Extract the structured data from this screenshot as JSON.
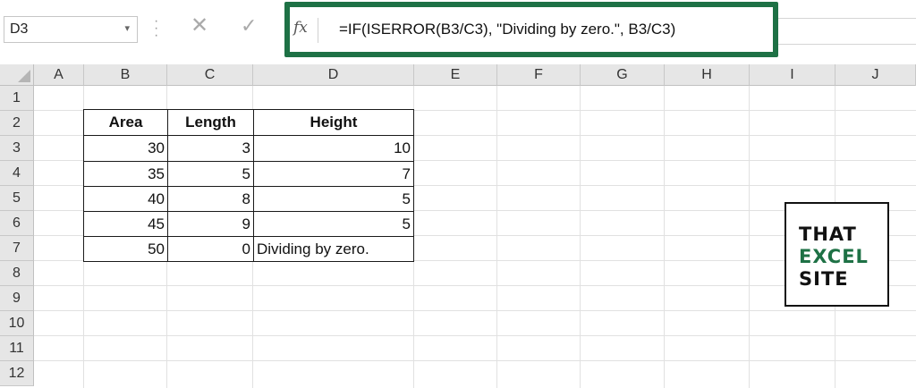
{
  "name_box": {
    "value": "D3"
  },
  "formula_bar": {
    "fx_label": "fx",
    "formula": "=IF(ISERROR(B3/C3), \"Dividing by zero.\", B3/C3)"
  },
  "columns": [
    "A",
    "B",
    "C",
    "D",
    "E",
    "F",
    "G",
    "H",
    "I",
    "J"
  ],
  "rows": [
    "1",
    "2",
    "3",
    "4",
    "5",
    "6",
    "7",
    "8",
    "9",
    "10",
    "11",
    "12"
  ],
  "table": {
    "headers": [
      "Area",
      "Length",
      "Height"
    ],
    "rows": [
      [
        "30",
        "3",
        "10"
      ],
      [
        "35",
        "5",
        "7"
      ],
      [
        "40",
        "8",
        "5"
      ],
      [
        "45",
        "9",
        "5"
      ],
      [
        "50",
        "0",
        "Dividing by zero."
      ]
    ]
  },
  "logo": {
    "line1": "THAT",
    "line2": "EXCEL",
    "line3": "SITE",
    "accent_color": "#1e7145"
  },
  "colors": {
    "highlight_border": "#1e7145"
  }
}
